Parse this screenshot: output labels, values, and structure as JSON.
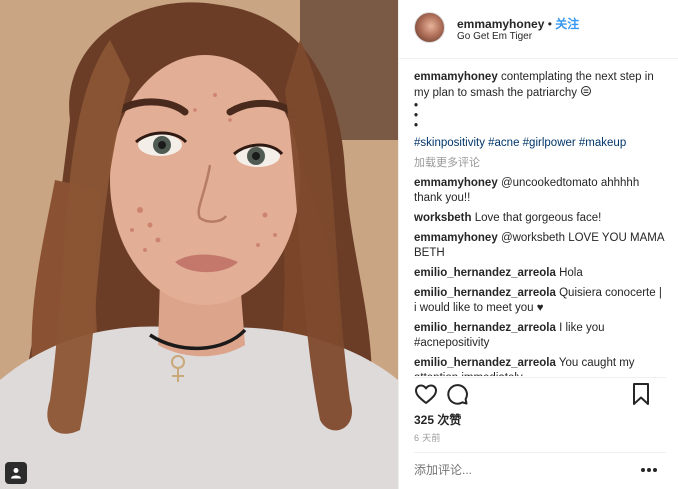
{
  "header": {
    "username": "emmamyhoney",
    "separator": "•",
    "follow_label": "关注",
    "location": "Go Get Em Tiger"
  },
  "post": {
    "caption_user": "emmamyhoney",
    "caption_text": "contemplating the next step in my plan to smash the patriarchy",
    "caption_dots": "•\n•\n•",
    "hashtags": "#skinpositivity #acne #girlpower #makeup",
    "load_more": "加载更多评论"
  },
  "comments": [
    {
      "user": "emmamyhoney",
      "text": "@uncookedtomato ahhhhh thank you!!"
    },
    {
      "user": "worksbeth",
      "text": "Love that gorgeous face!"
    },
    {
      "user": "emmamyhoney",
      "text": "@worksbeth LOVE YOU MAMA BETH"
    },
    {
      "user": "emilio_hernandez_arreola",
      "text": "Hola"
    },
    {
      "user": "emilio_hernandez_arreola",
      "text": "Quisiera conocerte | i would like to meet you ♥"
    },
    {
      "user": "emilio_hernandez_arreola",
      "text": "I like you #acnepositivity"
    },
    {
      "user": "emilio_hernandez_arreola",
      "text": "You caught my attention immediately"
    }
  ],
  "stats": {
    "likes": "325 次赞",
    "time": "6 天前"
  },
  "add_comment": {
    "placeholder": "添加评论..."
  },
  "icons": {
    "like": "heart-icon",
    "comment": "comment-icon",
    "save": "bookmark-icon",
    "more": "more-options-icon",
    "user_tag": "user-tag-icon"
  },
  "colors": {
    "follow": "#3897f0",
    "hashtag": "#003569",
    "muted": "#999999",
    "text": "#262626"
  }
}
